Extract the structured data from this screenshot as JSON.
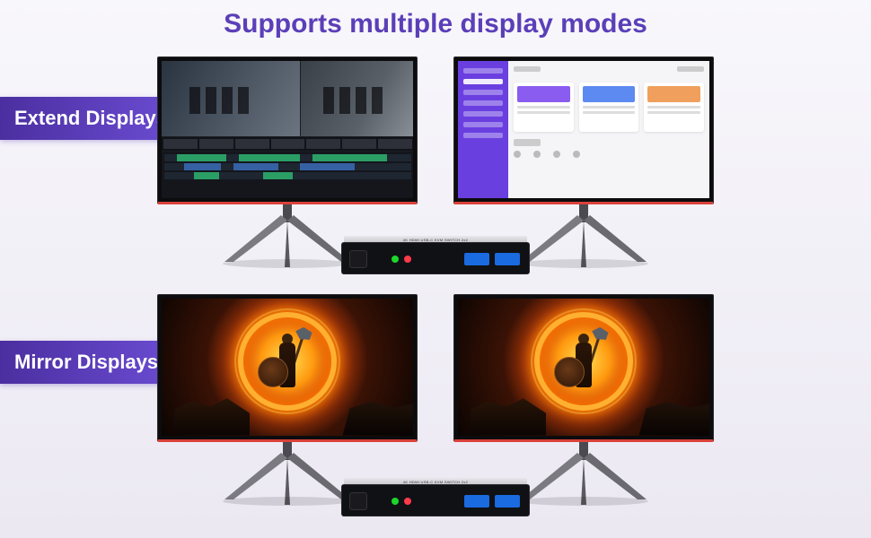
{
  "title": "Supports multiple display modes",
  "badges": {
    "extend": "Extend Displays",
    "mirror": "Mirror Displays"
  },
  "device": {
    "model_text": "4K HDMI USB-C KVM SWITCH 2x2"
  },
  "colors": {
    "accent_purple": "#5b3fb8",
    "badge_gradient_start": "#4b2fa0",
    "badge_gradient_end": "#6d4ed6",
    "monitor_accent": "#d9423a"
  },
  "screens": {
    "extend_left": "video-editor",
    "extend_right": "dashboard-app",
    "mirror_both": "fantasy-warrior"
  }
}
